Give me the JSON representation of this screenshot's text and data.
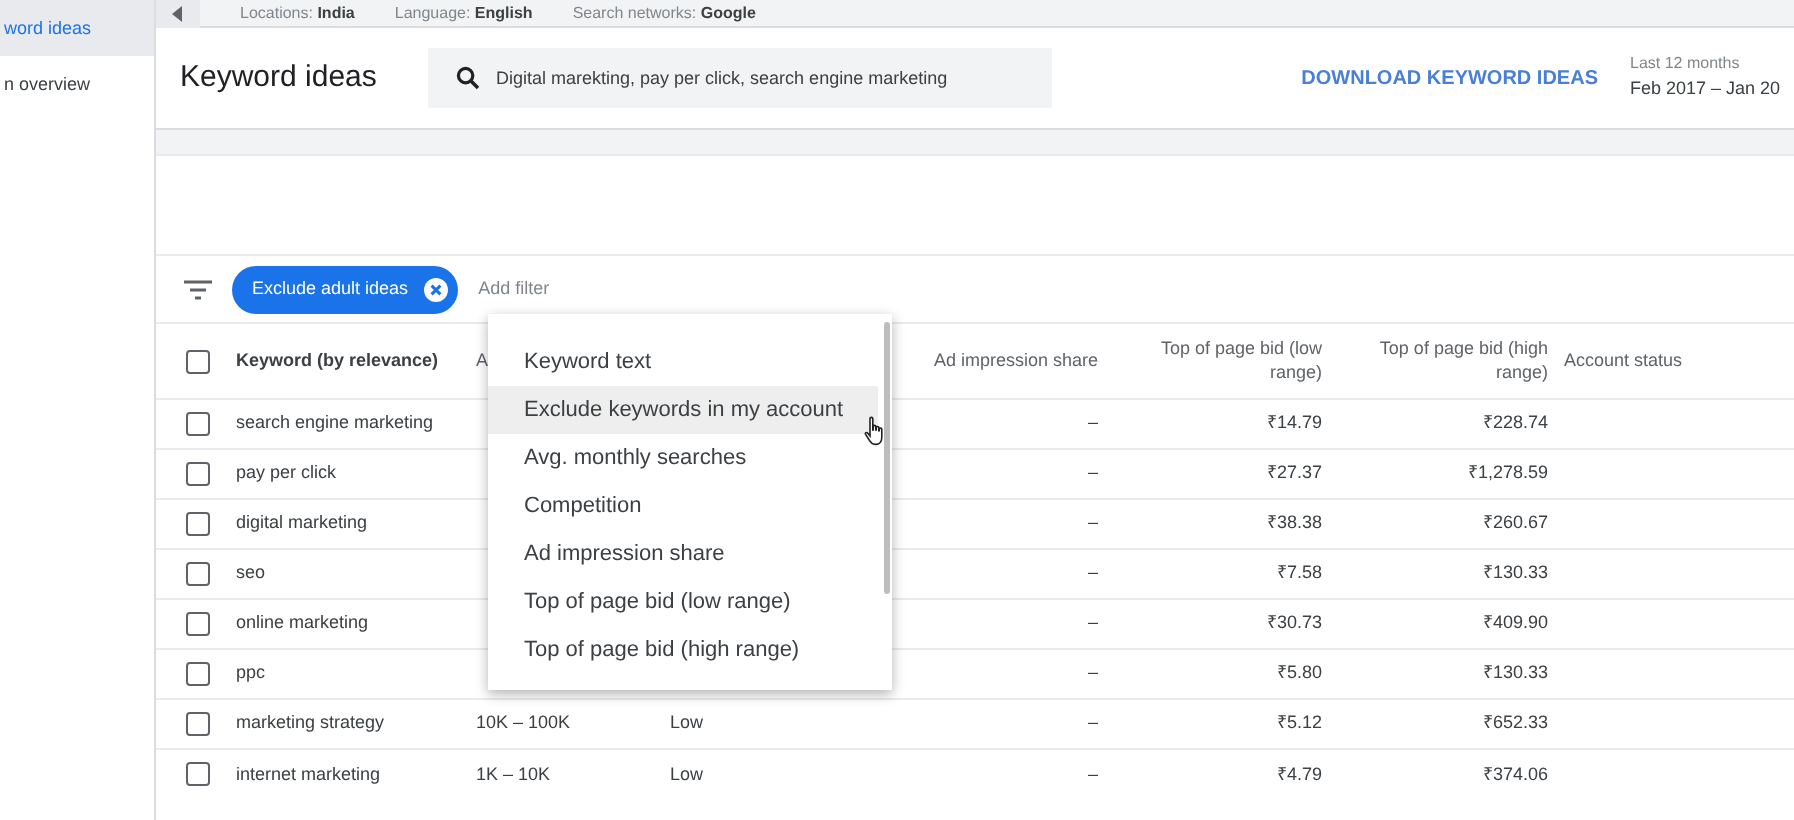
{
  "sidebar": {
    "items": [
      {
        "label": "word ideas",
        "selected": true
      },
      {
        "label": "n overview",
        "selected": false
      }
    ]
  },
  "top_bar": {
    "items": [
      {
        "label": "Locations:",
        "value": "India"
      },
      {
        "label": "Language:",
        "value": "English"
      },
      {
        "label": "Search networks:",
        "value": "Google"
      }
    ]
  },
  "header": {
    "title": "Keyword ideas",
    "search": {
      "value": "Digital marekting, pay per click, search engine marketing"
    },
    "download_button": "DOWNLOAD KEYWORD IDEAS",
    "date_range": {
      "label": "Last 12 months",
      "value": "Feb 2017 – Jan 20"
    }
  },
  "filters": {
    "chips": [
      {
        "label": "Exclude adult ideas"
      }
    ],
    "add_filter": "Add filter"
  },
  "table": {
    "select_all": {
      "checked": false
    },
    "columns": [
      {
        "label": "Keyword (by relevance)"
      },
      {
        "label": "A"
      },
      {},
      {
        "label": "Ad impression share"
      },
      {
        "label": "Top of page bid (low range)"
      },
      {
        "label": "Top of page bid (high range)"
      },
      {
        "label": "Account status"
      }
    ],
    "rows": [
      {
        "checked": false,
        "cells": [
          "search engine marketing",
          null,
          null,
          "–",
          "₹14.79",
          "₹228.74",
          null
        ]
      },
      {
        "checked": false,
        "cells": [
          "pay per click",
          null,
          null,
          "–",
          "₹27.37",
          "₹1,278.59",
          null
        ]
      },
      {
        "checked": false,
        "cells": [
          "digital marketing",
          null,
          null,
          "–",
          "₹38.38",
          "₹260.67",
          null
        ]
      },
      {
        "checked": false,
        "cells": [
          "seo",
          null,
          null,
          "–",
          "₹7.58",
          "₹130.33",
          null
        ]
      },
      {
        "checked": false,
        "cells": [
          "online marketing",
          null,
          null,
          "–",
          "₹30.73",
          "₹409.90",
          null
        ]
      },
      {
        "checked": false,
        "cells": [
          "ppc",
          null,
          null,
          "–",
          "₹5.80",
          "₹130.33",
          null
        ]
      },
      {
        "checked": false,
        "cells": [
          "marketing strategy",
          "10K – 100K",
          "Low",
          "–",
          "₹5.12",
          "₹652.33",
          null
        ]
      },
      {
        "checked": false,
        "cells": [
          "internet marketing",
          "1K – 10K",
          "Low",
          "–",
          "₹4.79",
          "₹374.06",
          null
        ]
      }
    ]
  },
  "filter_menu": {
    "items": [
      {
        "label": "Keyword text",
        "highlighted": false
      },
      {
        "label": "Exclude keywords in my account",
        "highlighted": true
      },
      {
        "label": "Avg. monthly searches",
        "highlighted": false
      },
      {
        "label": "Competition",
        "highlighted": false
      },
      {
        "label": "Ad impression share",
        "highlighted": false
      },
      {
        "label": "Top of page bid (low range)",
        "highlighted": false
      },
      {
        "label": "Top of page bid (high range)",
        "highlighted": false
      }
    ]
  }
}
